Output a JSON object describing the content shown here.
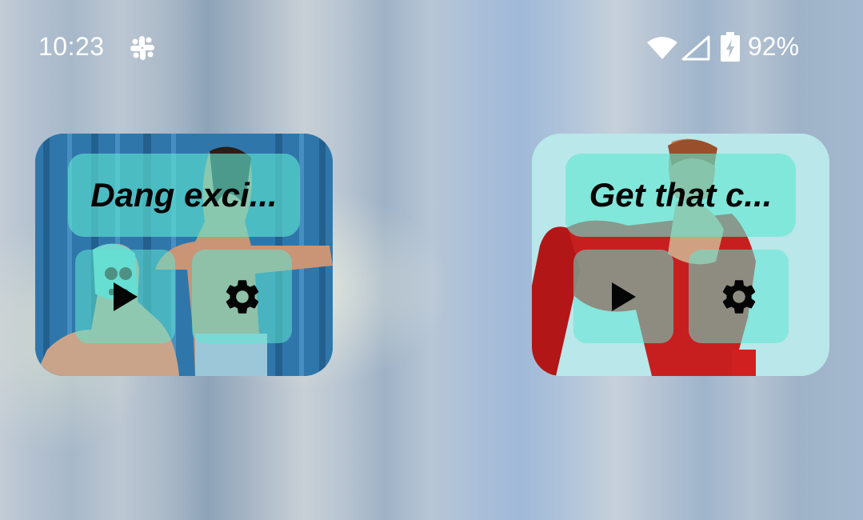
{
  "status_bar": {
    "time": "10:23",
    "battery_percent": "92%",
    "icons": [
      "slack-icon",
      "wifi-icon",
      "cell-signal-icon",
      "battery-charging-icon"
    ],
    "battery_level": 0.92
  },
  "widgets": [
    {
      "title": "Dang exci...",
      "image": "wrestlers-photo",
      "buttons": [
        {
          "icon": "play-icon"
        },
        {
          "icon": "gear-icon"
        }
      ]
    },
    {
      "title": "Get that c...",
      "image": "caped-wrestler-photo",
      "buttons": [
        {
          "icon": "play-icon"
        },
        {
          "icon": "gear-icon"
        }
      ]
    }
  ],
  "colors": {
    "overlay_accent": "#5fe6d2",
    "text": "#050505",
    "status_text": "#ffffff"
  }
}
